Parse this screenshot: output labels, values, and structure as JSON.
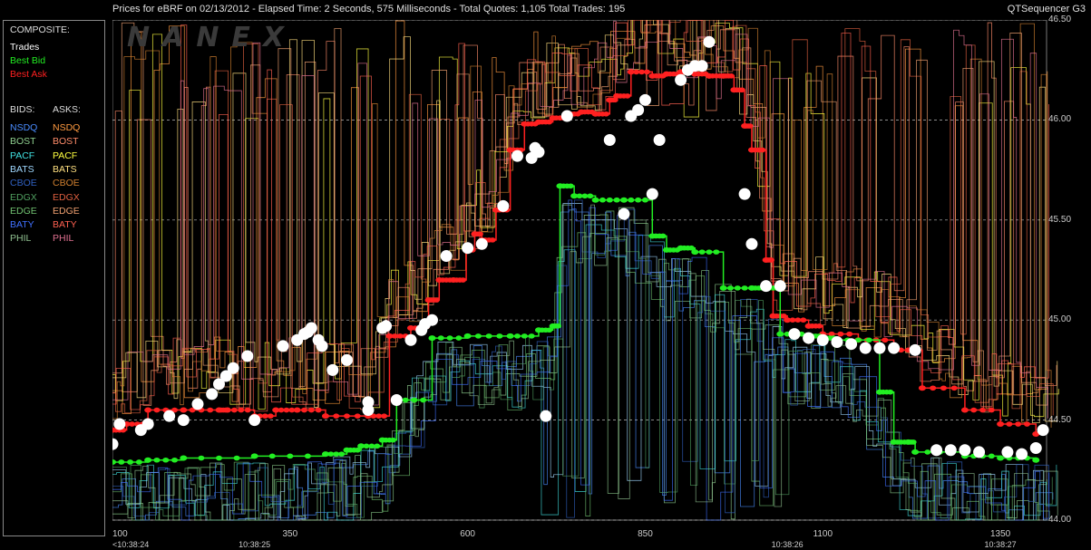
{
  "header": {
    "title": "Prices for  eBRF  on  02/13/2012  -  Elapsed Time: 2 Seconds, 575 Milliseconds  -  Total Quotes: 1,105  Total Trades: 195",
    "app_name": "QTSequencer G3",
    "watermark": "NANEX"
  },
  "legend": {
    "composite_label": "COMPOSITE:",
    "composite": [
      {
        "label": "Trades",
        "color": "#ffffff"
      },
      {
        "label": "Best Bid",
        "color": "#22ee22"
      },
      {
        "label": "Best Ask",
        "color": "#ff2020"
      }
    ],
    "bids_label": "BIDS:",
    "asks_label": "ASKS:",
    "exchanges": [
      {
        "bid": "NSDQ",
        "ask": "NSDQ",
        "bid_color": "#4a8cff",
        "ask_color": "#ff9a40"
      },
      {
        "bid": "BOST",
        "ask": "BOST",
        "bid_color": "#8fd08f",
        "ask_color": "#ff8c6a"
      },
      {
        "bid": "PACF",
        "ask": "PACF",
        "bid_color": "#40e0e0",
        "ask_color": "#ffff40"
      },
      {
        "bid": "BATS",
        "ask": "BATS",
        "bid_color": "#a0d8ff",
        "ask_color": "#ffe080"
      },
      {
        "bid": "CBOE",
        "ask": "CBOE",
        "bid_color": "#3060c0",
        "ask_color": "#d08030"
      },
      {
        "bid": "EDGX",
        "ask": "EDGX",
        "bid_color": "#50a060",
        "ask_color": "#e06040"
      },
      {
        "bid": "EDGE",
        "ask": "EDGE",
        "bid_color": "#70c070",
        "ask_color": "#f0a070"
      },
      {
        "bid": "BATY",
        "ask": "BATY",
        "bid_color": "#4070ff",
        "ask_color": "#ff6050"
      },
      {
        "bid": "PHIL",
        "ask": "PHIL",
        "bid_color": "#90c090",
        "ask_color": "#e07090"
      }
    ]
  },
  "chart_data": {
    "type": "line",
    "title": "Prices for  eBRF  on  02/13/2012",
    "xlabel": "",
    "ylabel": "",
    "xlim": [
      100,
      1415
    ],
    "ylim": [
      44.0,
      46.5
    ],
    "x_ticks": [
      "100",
      "350",
      "600",
      "850",
      "1100",
      "1350"
    ],
    "time_ticks": [
      {
        "x": 100,
        "label": "<10:38:24"
      },
      {
        "x": 300,
        "label": "10:38:25"
      },
      {
        "x": 1050,
        "label": "10:38:26"
      },
      {
        "x": 1350,
        "label": "10:38:27"
      }
    ],
    "y_ticks": [
      "44.00",
      "44.50",
      "45.00",
      "45.50",
      "46.00",
      "46.50"
    ],
    "grid": true,
    "series": [
      {
        "name": "Best Ask",
        "color": "#ff2020",
        "points": [
          [
            100,
            44.45
          ],
          [
            120,
            44.48
          ],
          [
            150,
            44.55
          ],
          [
            200,
            44.55
          ],
          [
            250,
            44.55
          ],
          [
            262,
            44.55
          ],
          [
            300,
            44.52
          ],
          [
            330,
            44.55
          ],
          [
            360,
            44.55
          ],
          [
            400,
            44.52
          ],
          [
            460,
            44.52
          ],
          [
            490,
            44.92
          ],
          [
            520,
            44.96
          ],
          [
            545,
            45.1
          ],
          [
            560,
            45.2
          ],
          [
            580,
            45.2
          ],
          [
            598,
            45.35
          ],
          [
            610,
            45.43
          ],
          [
            620,
            45.4
          ],
          [
            640,
            45.55
          ],
          [
            660,
            45.85
          ],
          [
            680,
            45.98
          ],
          [
            700,
            45.99
          ],
          [
            720,
            46.01
          ],
          [
            740,
            46.03
          ],
          [
            760,
            46.04
          ],
          [
            780,
            46.03
          ],
          [
            800,
            46.1
          ],
          [
            810,
            46.12
          ],
          [
            830,
            46.24
          ],
          [
            860,
            46.22
          ],
          [
            880,
            46.23
          ],
          [
            900,
            46.24
          ],
          [
            920,
            46.23
          ],
          [
            940,
            46.22
          ],
          [
            960,
            46.22
          ],
          [
            975,
            46.15
          ],
          [
            990,
            45.97
          ],
          [
            1000,
            45.85
          ],
          [
            1020,
            45.3
          ],
          [
            1030,
            45.02
          ],
          [
            1050,
            45.0
          ],
          [
            1080,
            44.97
          ],
          [
            1100,
            44.93
          ],
          [
            1150,
            44.9
          ],
          [
            1200,
            44.85
          ],
          [
            1240,
            44.66
          ],
          [
            1300,
            44.55
          ],
          [
            1350,
            44.48
          ],
          [
            1400,
            44.43
          ]
        ]
      },
      {
        "name": "Best Bid",
        "color": "#22ee22",
        "points": [
          [
            100,
            44.29
          ],
          [
            150,
            44.3
          ],
          [
            200,
            44.31
          ],
          [
            300,
            44.32
          ],
          [
            400,
            44.33
          ],
          [
            430,
            44.35
          ],
          [
            450,
            44.37
          ],
          [
            480,
            44.4
          ],
          [
            500,
            44.6
          ],
          [
            550,
            44.91
          ],
          [
            600,
            44.92
          ],
          [
            660,
            44.92
          ],
          [
            700,
            44.95
          ],
          [
            720,
            44.97
          ],
          [
            730,
            45.67
          ],
          [
            750,
            45.62
          ],
          [
            780,
            45.6
          ],
          [
            820,
            45.6
          ],
          [
            860,
            45.42
          ],
          [
            880,
            45.35
          ],
          [
            900,
            45.36
          ],
          [
            920,
            45.34
          ],
          [
            960,
            45.16
          ],
          [
            1000,
            45.16
          ],
          [
            1020,
            45.16
          ],
          [
            1040,
            44.93
          ],
          [
            1080,
            44.92
          ],
          [
            1100,
            44.91
          ],
          [
            1120,
            44.9
          ],
          [
            1180,
            44.64
          ],
          [
            1200,
            44.39
          ],
          [
            1220,
            44.39
          ],
          [
            1230,
            44.34
          ],
          [
            1300,
            44.32
          ],
          [
            1350,
            44.31
          ],
          [
            1400,
            44.3
          ]
        ]
      },
      {
        "name": "Trades",
        "color": "#ffffff",
        "points": [
          [
            100,
            44.38
          ],
          [
            110,
            44.48
          ],
          [
            140,
            44.45
          ],
          [
            150,
            44.48
          ],
          [
            180,
            44.52
          ],
          [
            200,
            44.5
          ],
          [
            220,
            44.58
          ],
          [
            240,
            44.63
          ],
          [
            250,
            44.68
          ],
          [
            260,
            44.72
          ],
          [
            270,
            44.76
          ],
          [
            290,
            44.82
          ],
          [
            300,
            44.5
          ],
          [
            340,
            44.87
          ],
          [
            360,
            44.9
          ],
          [
            370,
            44.93
          ],
          [
            375,
            44.94
          ],
          [
            380,
            44.96
          ],
          [
            390,
            44.9
          ],
          [
            395,
            44.87
          ],
          [
            410,
            44.75
          ],
          [
            430,
            44.8
          ],
          [
            460,
            44.55
          ],
          [
            460,
            44.59
          ],
          [
            480,
            44.96
          ],
          [
            485,
            44.97
          ],
          [
            500,
            44.6
          ],
          [
            520,
            44.9
          ],
          [
            535,
            44.95
          ],
          [
            540,
            44.98
          ],
          [
            550,
            45.0
          ],
          [
            570,
            45.32
          ],
          [
            600,
            45.36
          ],
          [
            620,
            45.38
          ],
          [
            650,
            45.57
          ],
          [
            670,
            45.82
          ],
          [
            690,
            45.81
          ],
          [
            695,
            45.86
          ],
          [
            700,
            45.84
          ],
          [
            710,
            44.52
          ],
          [
            740,
            46.02
          ],
          [
            800,
            45.9
          ],
          [
            820,
            45.53
          ],
          [
            830,
            46.02
          ],
          [
            840,
            46.05
          ],
          [
            850,
            46.1
          ],
          [
            860,
            45.63
          ],
          [
            870,
            45.9
          ],
          [
            900,
            46.2
          ],
          [
            910,
            46.25
          ],
          [
            920,
            46.27
          ],
          [
            930,
            46.27
          ],
          [
            940,
            46.39
          ],
          [
            990,
            45.63
          ],
          [
            1000,
            45.38
          ],
          [
            1020,
            45.17
          ],
          [
            1040,
            45.17
          ],
          [
            1060,
            44.93
          ],
          [
            1080,
            44.91
          ],
          [
            1100,
            44.9
          ],
          [
            1120,
            44.89
          ],
          [
            1140,
            44.88
          ],
          [
            1160,
            44.86
          ],
          [
            1180,
            44.86
          ],
          [
            1200,
            44.86
          ],
          [
            1230,
            44.85
          ],
          [
            1260,
            44.35
          ],
          [
            1280,
            44.35
          ],
          [
            1300,
            44.35
          ],
          [
            1320,
            44.34
          ],
          [
            1360,
            44.34
          ],
          [
            1380,
            44.33
          ],
          [
            1400,
            44.36
          ],
          [
            1410,
            44.45
          ]
        ]
      }
    ],
    "exchange_quote_lines": true
  }
}
